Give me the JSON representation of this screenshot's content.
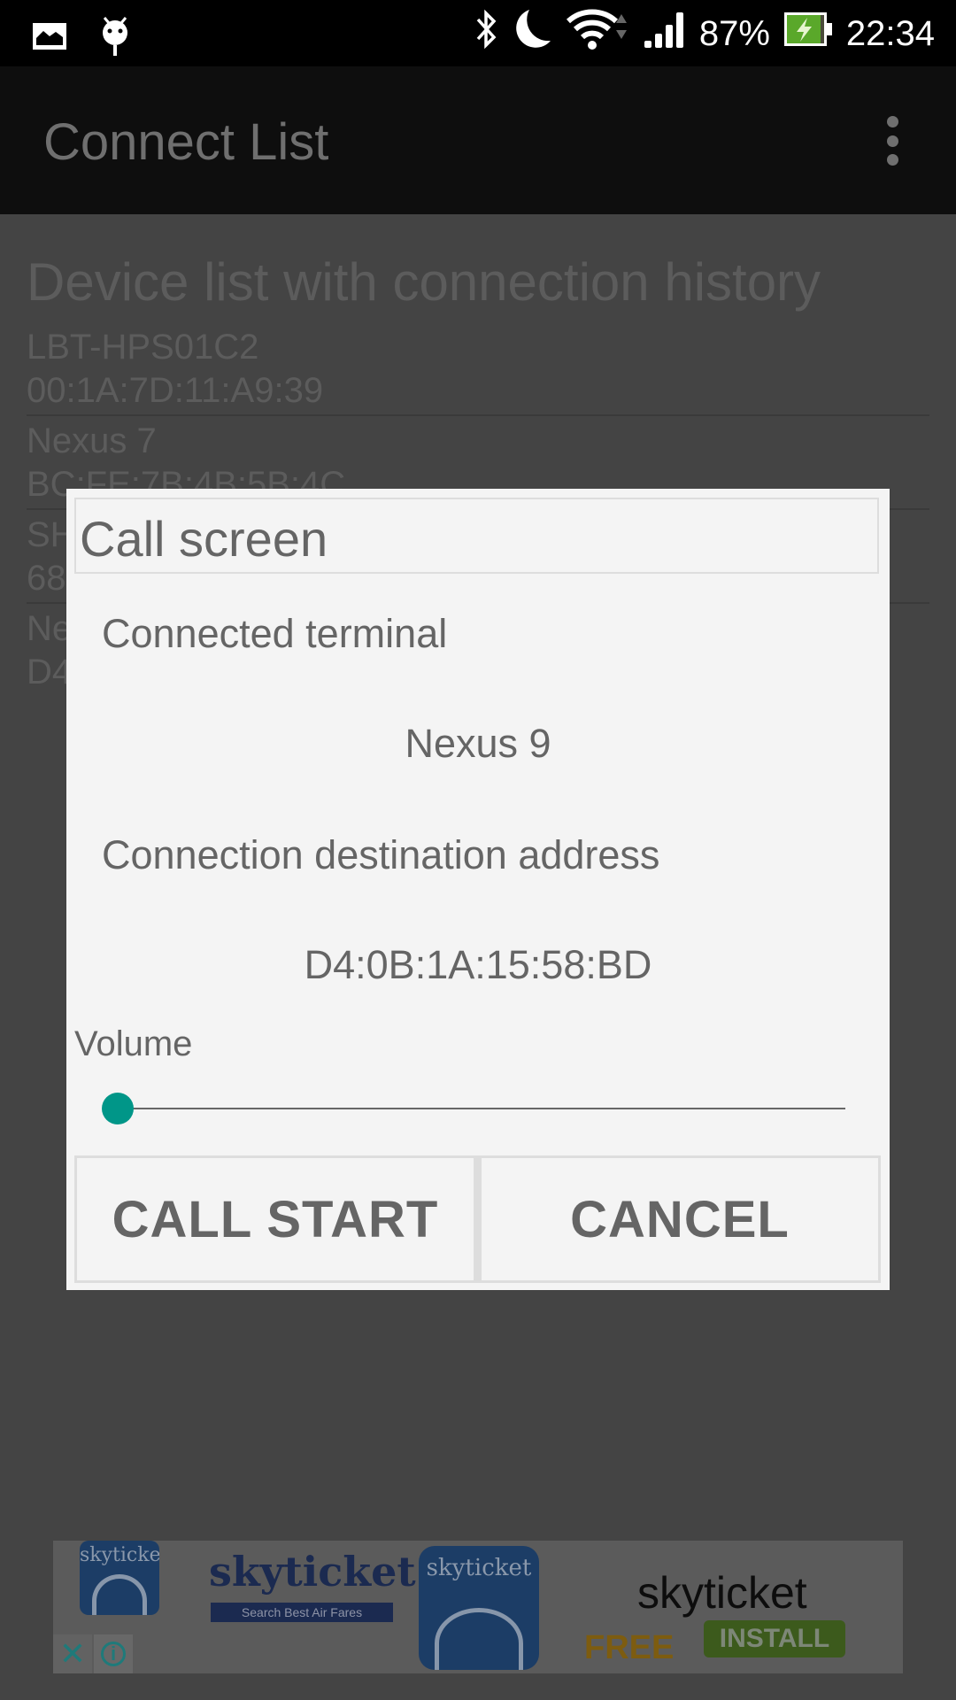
{
  "status_bar": {
    "left_icons": [
      "gallery-icon",
      "android-debug-icon"
    ],
    "right_icons": [
      "bluetooth-icon",
      "do-not-disturb-moon-icon",
      "wifi-icon",
      "cell-signal-icon",
      "battery-charging-icon"
    ],
    "battery_percent": "87%",
    "battery_level": 0.87,
    "time": "22:34"
  },
  "app_bar": {
    "title": "Connect List",
    "menu_icon": "overflow-menu-icon"
  },
  "content": {
    "heading": "Device list with connection history",
    "devices": [
      {
        "name": "LBT-HPS01C2",
        "address": "00:1A:7D:11:A9:39"
      },
      {
        "name": "Nexus 7",
        "address": "BC:FE:7B:4B:5B:4C"
      },
      {
        "name": "SH",
        "address": "68"
      },
      {
        "name": "Ne",
        "address": "D4"
      }
    ]
  },
  "dialog": {
    "title": "Call screen",
    "connected_terminal_label": "Connected terminal",
    "connected_terminal_value": "Nexus 9",
    "address_label": "Connection destination address",
    "address_value": "D4:0B:1A:15:58:BD",
    "volume_label": "Volume",
    "volume_value": 0,
    "accent_color": "#009688",
    "buttons": {
      "call_start": "CALL START",
      "cancel": "CANCEL"
    }
  },
  "ad": {
    "brand_logo_text": "skyticket",
    "tagline": "Search Best Air Fares",
    "icon_text": "skyticket",
    "app_name": "skyticket",
    "price": "FREE",
    "install_label": "INSTALL",
    "close_glyph": "✕",
    "info_glyph": "i"
  }
}
